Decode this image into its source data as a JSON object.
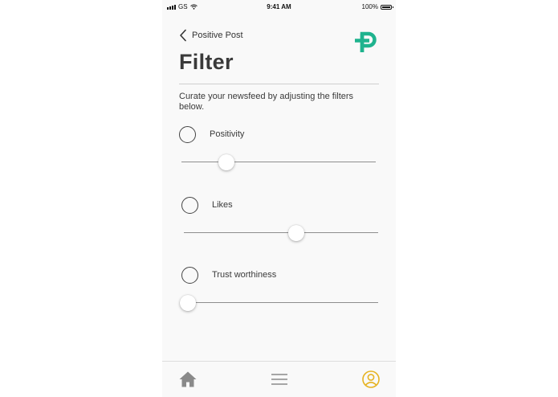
{
  "status_bar": {
    "carrier": "GS",
    "time": "9:41 AM",
    "battery": "100%"
  },
  "header": {
    "back_label": "Positive Post",
    "title": "Filter",
    "logo_icon": "positive-post-logo",
    "logo_color": "#1fb38e"
  },
  "description": "Curate your newsfeed by adjusting the filters below.",
  "filters": [
    {
      "label": "Positivity",
      "value": 0.23
    },
    {
      "label": "Likes",
      "value": 0.58
    },
    {
      "label": "Trust worthiness",
      "value": 0.02
    }
  ],
  "tab_bar": {
    "items": [
      {
        "icon": "home-icon",
        "active": false
      },
      {
        "icon": "menu-icon",
        "active": false
      },
      {
        "icon": "profile-icon",
        "active": true
      }
    ],
    "active_color": "#e6b322",
    "inactive_color": "#8a8a8a"
  }
}
